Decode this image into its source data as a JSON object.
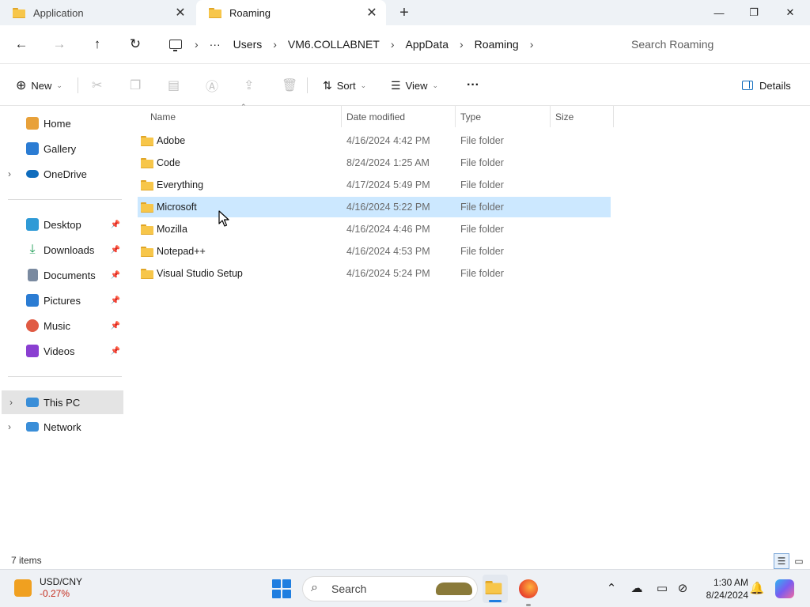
{
  "tabs": [
    {
      "label": "Application",
      "active": false
    },
    {
      "label": "Roaming",
      "active": true
    }
  ],
  "window_controls": {
    "minimize": "—",
    "maximize": "❐",
    "close": "✕"
  },
  "address": {
    "crumbs": [
      "Users",
      "VM6.COLLABNET",
      "AppData",
      "Roaming"
    ],
    "ellipsis": "···",
    "search_placeholder": "Search Roaming"
  },
  "toolbar": {
    "new_label": "New",
    "sort_label": "Sort",
    "view_label": "View",
    "more_label": "···",
    "details_label": "Details"
  },
  "sidebar": {
    "top": [
      {
        "label": "Home",
        "color": "#e8a13a"
      },
      {
        "label": "Gallery",
        "color": "#2b7cd3"
      },
      {
        "label": "OneDrive",
        "color": "#0f6cbd"
      }
    ],
    "pinned": [
      {
        "label": "Desktop",
        "color": "#2f9ad6"
      },
      {
        "label": "Downloads",
        "color": "#1f9e57"
      },
      {
        "label": "Documents",
        "color": "#7a8aa0"
      },
      {
        "label": "Pictures",
        "color": "#2b7cd3"
      },
      {
        "label": "Music",
        "color": "#e05a43"
      },
      {
        "label": "Videos",
        "color": "#8a3fd1"
      }
    ],
    "bottom": [
      {
        "label": "This PC",
        "color": "#3a8ed8",
        "selected": true
      },
      {
        "label": "Network",
        "color": "#3a8ed8",
        "selected": false
      }
    ]
  },
  "columns": {
    "name": "Name",
    "date": "Date modified",
    "type": "Type",
    "size": "Size"
  },
  "files": [
    {
      "name": "Adobe",
      "date": "4/16/2024 4:42 PM",
      "type": "File folder",
      "size": ""
    },
    {
      "name": "Code",
      "date": "8/24/2024 1:25 AM",
      "type": "File folder",
      "size": ""
    },
    {
      "name": "Everything",
      "date": "4/17/2024 5:49 PM",
      "type": "File folder",
      "size": ""
    },
    {
      "name": "Microsoft",
      "date": "4/16/2024 5:22 PM",
      "type": "File folder",
      "size": "",
      "selected": true
    },
    {
      "name": "Mozilla",
      "date": "4/16/2024 4:46 PM",
      "type": "File folder",
      "size": ""
    },
    {
      "name": "Notepad++",
      "date": "4/16/2024 4:53 PM",
      "type": "File folder",
      "size": ""
    },
    {
      "name": "Visual Studio Setup",
      "date": "4/16/2024 5:24 PM",
      "type": "File folder",
      "size": ""
    }
  ],
  "status": {
    "item_count": "7 items"
  },
  "taskbar": {
    "ticker_symbol": "USD/CNY",
    "ticker_change": "-0.27%",
    "search_label": "Search",
    "time": "1:30 AM",
    "date": "8/24/2024",
    "accent": "#1f7ee0"
  }
}
